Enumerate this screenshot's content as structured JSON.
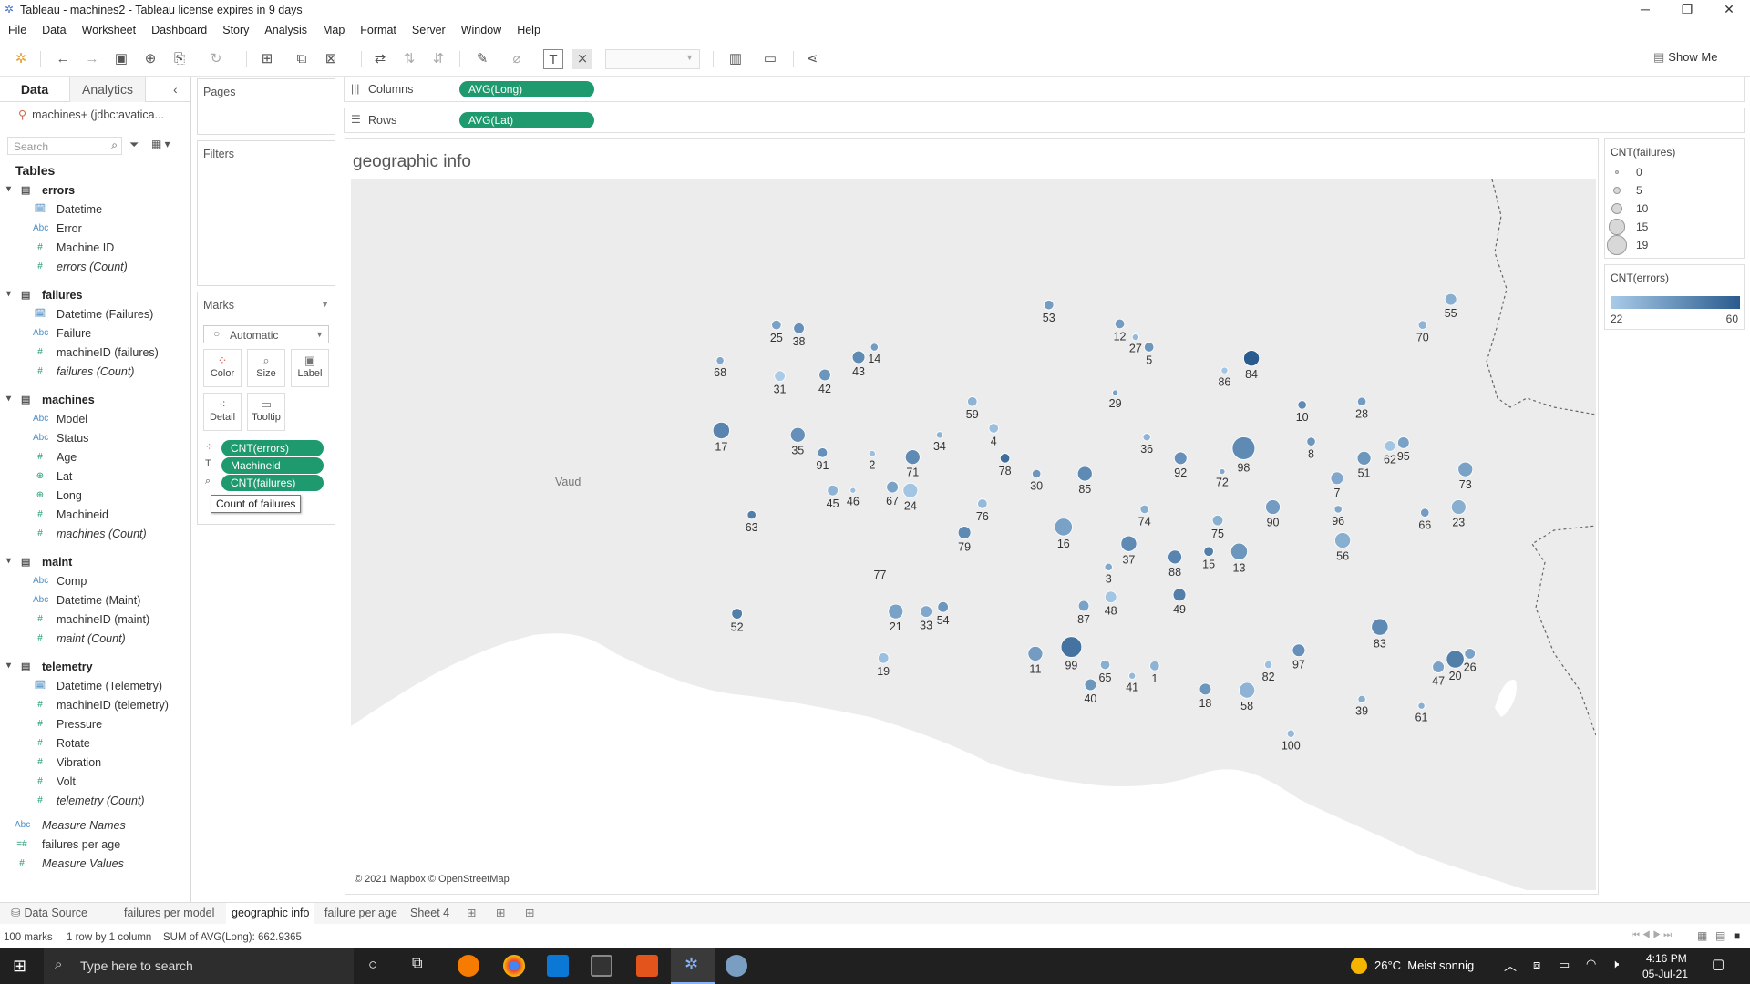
{
  "window": {
    "title": "Tableau - machines2 - Tableau license expires in 9 days"
  },
  "menu": [
    "File",
    "Data",
    "Worksheet",
    "Dashboard",
    "Story",
    "Analysis",
    "Map",
    "Format",
    "Server",
    "Window",
    "Help"
  ],
  "toolbar": {
    "show_me": "Show Me"
  },
  "data_pane": {
    "tab_data": "Data",
    "tab_analytics": "Analytics",
    "datasource": "machines+ (jdbc:avatica...",
    "search_placeholder": "Search",
    "tables_label": "Tables",
    "tables": [
      {
        "name": "errors",
        "fields": [
          {
            "type": "date",
            "name": "Datetime"
          },
          {
            "type": "abc",
            "name": "Error"
          },
          {
            "type": "num",
            "name": "Machine ID"
          },
          {
            "type": "num",
            "name": "errors (Count)",
            "italic": true
          }
        ]
      },
      {
        "name": "failures",
        "fields": [
          {
            "type": "date",
            "name": "Datetime (Failures)"
          },
          {
            "type": "abc",
            "name": "Failure"
          },
          {
            "type": "num",
            "name": "machineID (failures)"
          },
          {
            "type": "num",
            "name": "failures (Count)",
            "italic": true
          }
        ]
      },
      {
        "name": "machines",
        "fields": [
          {
            "type": "abc",
            "name": "Model"
          },
          {
            "type": "abc",
            "name": "Status"
          },
          {
            "type": "num",
            "name": "Age"
          },
          {
            "type": "geo",
            "name": "Lat"
          },
          {
            "type": "geo",
            "name": "Long"
          },
          {
            "type": "num",
            "name": "Machineid"
          },
          {
            "type": "num",
            "name": "machines (Count)",
            "italic": true
          }
        ]
      },
      {
        "name": "maint",
        "fields": [
          {
            "type": "abc",
            "name": "Comp"
          },
          {
            "type": "abc",
            "name": "Datetime (Maint)"
          },
          {
            "type": "num",
            "name": "machineID (maint)"
          },
          {
            "type": "num",
            "name": "maint (Count)",
            "italic": true
          }
        ]
      },
      {
        "name": "telemetry",
        "fields": [
          {
            "type": "date",
            "name": "Datetime (Telemetry)"
          },
          {
            "type": "num",
            "name": "machineID (telemetry)"
          },
          {
            "type": "num",
            "name": "Pressure"
          },
          {
            "type": "num",
            "name": "Rotate"
          },
          {
            "type": "num",
            "name": "Vibration"
          },
          {
            "type": "num",
            "name": "Volt"
          },
          {
            "type": "num",
            "name": "telemetry (Count)",
            "italic": true
          }
        ]
      }
    ],
    "extra": [
      {
        "type": "abc",
        "name": "Measure Names"
      },
      {
        "type": "calc",
        "name": "failures per age"
      },
      {
        "type": "num",
        "name": "Measure Values"
      }
    ]
  },
  "cards": {
    "pages": "Pages",
    "filters": "Filters",
    "marks": "Marks",
    "mark_type": "Automatic",
    "buttons": {
      "color": "Color",
      "size": "Size",
      "label": "Label",
      "detail": "Detail",
      "tooltip": "Tooltip"
    },
    "mark_pills": [
      "CNT(errors)",
      "Machineid",
      "CNT(failures)"
    ],
    "tooltip_hint": "Count of failures"
  },
  "shelves": {
    "columns_label": "Columns",
    "columns_pill": "AVG(Long)",
    "rows_label": "Rows",
    "rows_pill": "AVG(Lat)"
  },
  "view": {
    "title": "geographic info",
    "attribution": "© 2021 Mapbox © OpenStreetMap",
    "place_label": "Vaud"
  },
  "legends": {
    "size_title": "CNT(failures)",
    "size_items": [
      "0",
      "5",
      "10",
      "15",
      "19"
    ],
    "color_title": "CNT(errors)",
    "color_min": "22",
    "color_max": "60",
    "colors": {
      "low": "#a9cbe8",
      "high": "#2a5b8e"
    }
  },
  "chart_data": {
    "type": "scatter",
    "title": "geographic info",
    "points": [
      {
        "id": "53",
        "errors": 38,
        "failures": 6
      },
      {
        "id": "12",
        "errors": 38,
        "failures": 6
      },
      {
        "id": "27",
        "errors": 28,
        "failures": 3
      },
      {
        "id": "5",
        "errors": 40,
        "failures": 6
      },
      {
        "id": "55",
        "errors": 32,
        "failures": 8
      },
      {
        "id": "70",
        "errors": 30,
        "failures": 5
      },
      {
        "id": "25",
        "errors": 36,
        "failures": 6
      },
      {
        "id": "38",
        "errors": 42,
        "failures": 7
      },
      {
        "id": "14",
        "errors": 38,
        "failures": 4
      },
      {
        "id": "68",
        "errors": 34,
        "failures": 4
      },
      {
        "id": "31",
        "errors": 22,
        "failures": 7
      },
      {
        "id": "42",
        "errors": 40,
        "failures": 8
      },
      {
        "id": "43",
        "errors": 44,
        "failures": 9
      },
      {
        "id": "86",
        "errors": 24,
        "failures": 3
      },
      {
        "id": "84",
        "errors": 60,
        "failures": 12
      },
      {
        "id": "29",
        "errors": 36,
        "failures": 2
      },
      {
        "id": "10",
        "errors": 44,
        "failures": 5
      },
      {
        "id": "28",
        "errors": 38,
        "failures": 5
      },
      {
        "id": "59",
        "errors": 30,
        "failures": 6
      },
      {
        "id": "17",
        "errors": 46,
        "failures": 13
      },
      {
        "id": "35",
        "errors": 42,
        "failures": 11
      },
      {
        "id": "91",
        "errors": 42,
        "failures": 6
      },
      {
        "id": "2",
        "errors": 26,
        "failures": 3
      },
      {
        "id": "71",
        "errors": 44,
        "failures": 11
      },
      {
        "id": "34",
        "errors": 30,
        "failures": 3
      },
      {
        "id": "4",
        "errors": 26,
        "failures": 6
      },
      {
        "id": "78",
        "errors": 54,
        "failures": 6
      },
      {
        "id": "30",
        "errors": 40,
        "failures": 5
      },
      {
        "id": "85",
        "errors": 44,
        "failures": 11
      },
      {
        "id": "36",
        "errors": 30,
        "failures": 4
      },
      {
        "id": "92",
        "errors": 42,
        "failures": 9
      },
      {
        "id": "98",
        "errors": 44,
        "failures": 19
      },
      {
        "id": "72",
        "errors": 34,
        "failures": 2
      },
      {
        "id": "8",
        "errors": 40,
        "failures": 5
      },
      {
        "id": "7",
        "errors": 34,
        "failures": 9
      },
      {
        "id": "51",
        "errors": 40,
        "failures": 10
      },
      {
        "id": "62",
        "errors": 24,
        "failures": 7
      },
      {
        "id": "95",
        "errors": 36,
        "failures": 8
      },
      {
        "id": "73",
        "errors": 36,
        "failures": 11
      },
      {
        "id": "45",
        "errors": 30,
        "failures": 7
      },
      {
        "id": "46",
        "errors": 26,
        "failures": 2
      },
      {
        "id": "67",
        "errors": 36,
        "failures": 8
      },
      {
        "id": "24",
        "errors": 24,
        "failures": 11
      },
      {
        "id": "63",
        "errors": 48,
        "failures": 5
      },
      {
        "id": "76",
        "errors": 28,
        "failures": 6
      },
      {
        "id": "79",
        "errors": 44,
        "failures": 9
      },
      {
        "id": "16",
        "errors": 36,
        "failures": 14
      },
      {
        "id": "74",
        "errors": 32,
        "failures": 5
      },
      {
        "id": "90",
        "errors": 38,
        "failures": 11
      },
      {
        "id": "96",
        "errors": 34,
        "failures": 4
      },
      {
        "id": "66",
        "errors": 38,
        "failures": 5
      },
      {
        "id": "23",
        "errors": 32,
        "failures": 11
      },
      {
        "id": "75",
        "errors": 32,
        "failures": 7
      },
      {
        "id": "88",
        "errors": 46,
        "failures": 10
      },
      {
        "id": "15",
        "errors": 48,
        "failures": 6
      },
      {
        "id": "13",
        "errors": 40,
        "failures": 13
      },
      {
        "id": "56",
        "errors": 32,
        "failures": 12
      },
      {
        "id": "37",
        "errors": 44,
        "failures": 12
      },
      {
        "id": "3",
        "errors": 34,
        "failures": 4
      },
      {
        "id": "48",
        "errors": 24,
        "failures": 8
      },
      {
        "id": "77",
        "errors": 30,
        "failures": 0
      },
      {
        "id": "49",
        "errors": 48,
        "failures": 9
      },
      {
        "id": "52",
        "errors": 48,
        "failures": 7
      },
      {
        "id": "21",
        "errors": 36,
        "failures": 11
      },
      {
        "id": "33",
        "errors": 34,
        "failures": 8
      },
      {
        "id": "54",
        "errors": 40,
        "failures": 7
      },
      {
        "id": "87",
        "errors": 36,
        "failures": 7
      },
      {
        "id": "83",
        "errors": 44,
        "failures": 13
      },
      {
        "id": "19",
        "errors": 26,
        "failures": 7
      },
      {
        "id": "11",
        "errors": 38,
        "failures": 11
      },
      {
        "id": "99",
        "errors": 52,
        "failures": 17
      },
      {
        "id": "65",
        "errors": 32,
        "failures": 6
      },
      {
        "id": "40",
        "errors": 40,
        "failures": 8
      },
      {
        "id": "41",
        "errors": 28,
        "failures": 3
      },
      {
        "id": "1",
        "errors": 30,
        "failures": 6
      },
      {
        "id": "18",
        "errors": 40,
        "failures": 8
      },
      {
        "id": "58",
        "errors": 30,
        "failures": 12
      },
      {
        "id": "82",
        "errors": 26,
        "failures": 4
      },
      {
        "id": "97",
        "errors": 42,
        "failures": 9
      },
      {
        "id": "47",
        "errors": 36,
        "failures": 8
      },
      {
        "id": "20",
        "errors": 48,
        "failures": 14
      },
      {
        "id": "26",
        "errors": 36,
        "failures": 7
      },
      {
        "id": "39",
        "errors": 32,
        "failures": 4
      },
      {
        "id": "61",
        "errors": 32,
        "failures": 3
      },
      {
        "id": "100",
        "errors": 28,
        "failures": 4
      }
    ]
  },
  "sheet_tabs": {
    "data_source": "Data Source",
    "tabs": [
      "failures per model",
      "geographic info",
      "failure per age",
      "Sheet 4"
    ]
  },
  "status": {
    "marks": "100 marks",
    "rows": "1 row by 1 column",
    "sum": "SUM of AVG(Long): 662.9365"
  },
  "taskbar": {
    "search_placeholder": "Type here to search",
    "weather": "26°C  Meist sonnig",
    "time": "4:16 PM",
    "date": "05-Jul-21"
  }
}
